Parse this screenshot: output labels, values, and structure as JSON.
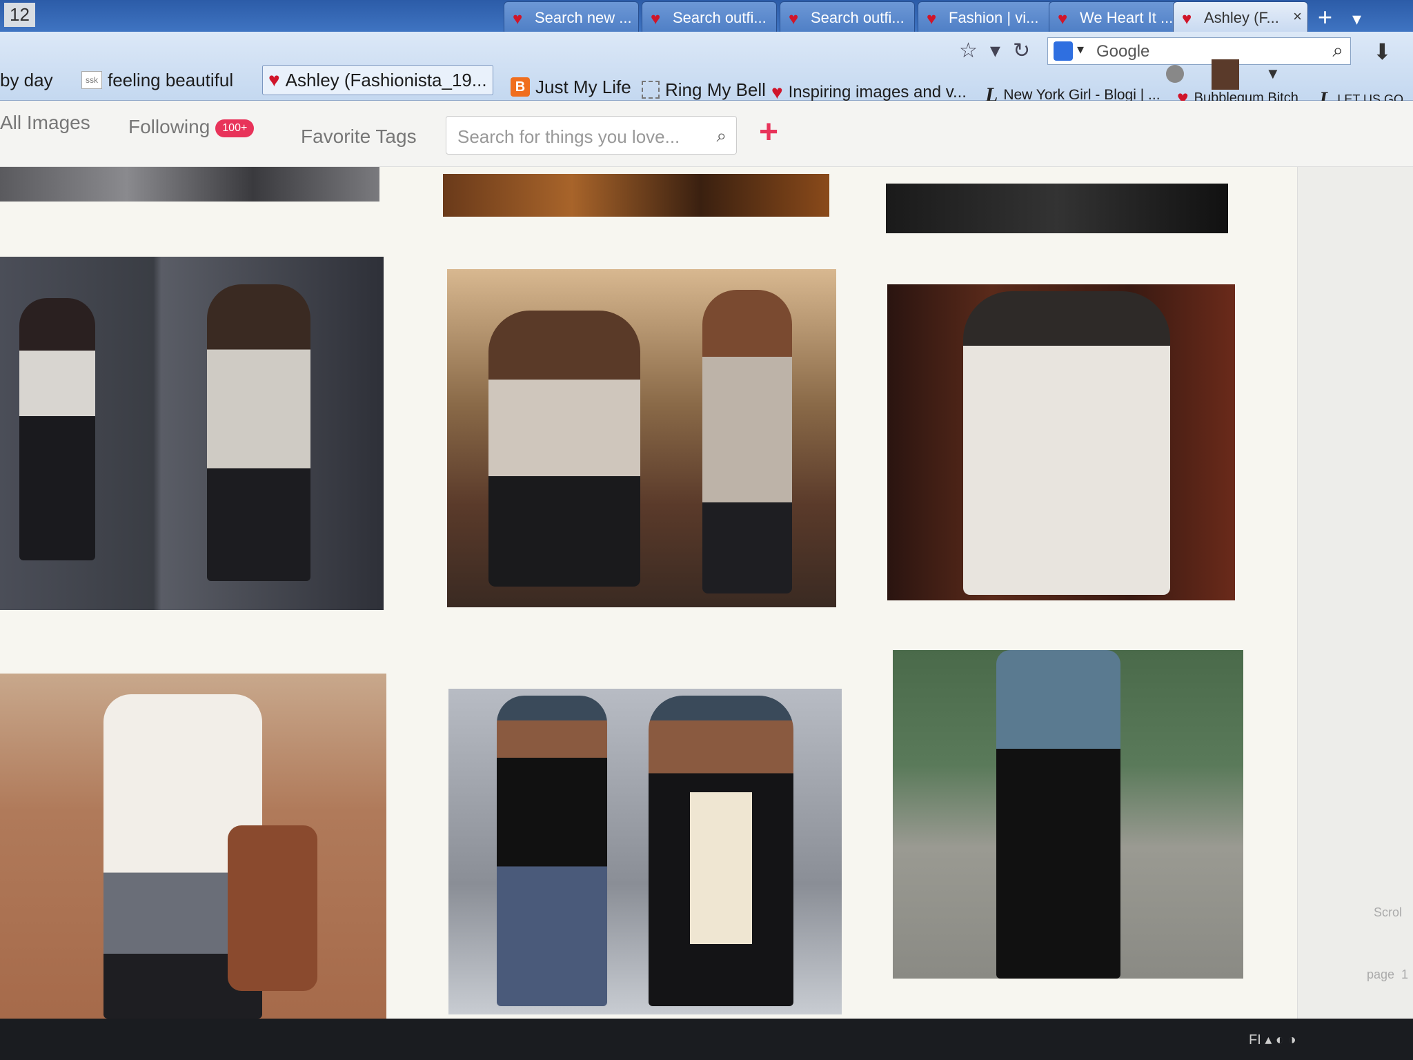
{
  "window": {
    "number_label": "12"
  },
  "tabs": [
    {
      "label": "Search new ..."
    },
    {
      "label": "Search outfi..."
    },
    {
      "label": "Search outfi..."
    },
    {
      "label": "Fashion | vi..."
    },
    {
      "label": "We Heart It ..."
    },
    {
      "label": "Ashley (F...",
      "close": "×"
    }
  ],
  "tabbar": {
    "new_tab": "+",
    "dropdown": "▾"
  },
  "bookmarks": [
    {
      "label": "by day"
    },
    {
      "label": "feeling beautiful"
    },
    {
      "label": "Ashley (Fashionista_19..."
    },
    {
      "label": "Just My Life"
    },
    {
      "label": "Ring My Bell"
    },
    {
      "label": "Inspiring images and v..."
    },
    {
      "label": "New York Girl - Blogi | ..."
    },
    {
      "label": "Bubblegum Bitch"
    },
    {
      "label": "LET US GO"
    }
  ],
  "search_engine": {
    "value": "Google"
  },
  "site_nav": {
    "all_images": "All Images",
    "following": "Following",
    "following_badge": "100+",
    "favorite_tags": "Favorite Tags",
    "search_placeholder": "Search for things you love...",
    "add": "+"
  },
  "sidebar": {
    "scroll_label": "Scrol",
    "page_label": "page",
    "page_num": "1"
  },
  "icons": {
    "heart": "heart-icon",
    "search": "search-icon",
    "star": "star-icon",
    "reload": "reload-icon",
    "download": "download-icon",
    "plus": "plus-icon"
  },
  "colors": {
    "accent": "#e8335a",
    "heart": "#d0152a",
    "tabbar": "#3f74c2"
  }
}
